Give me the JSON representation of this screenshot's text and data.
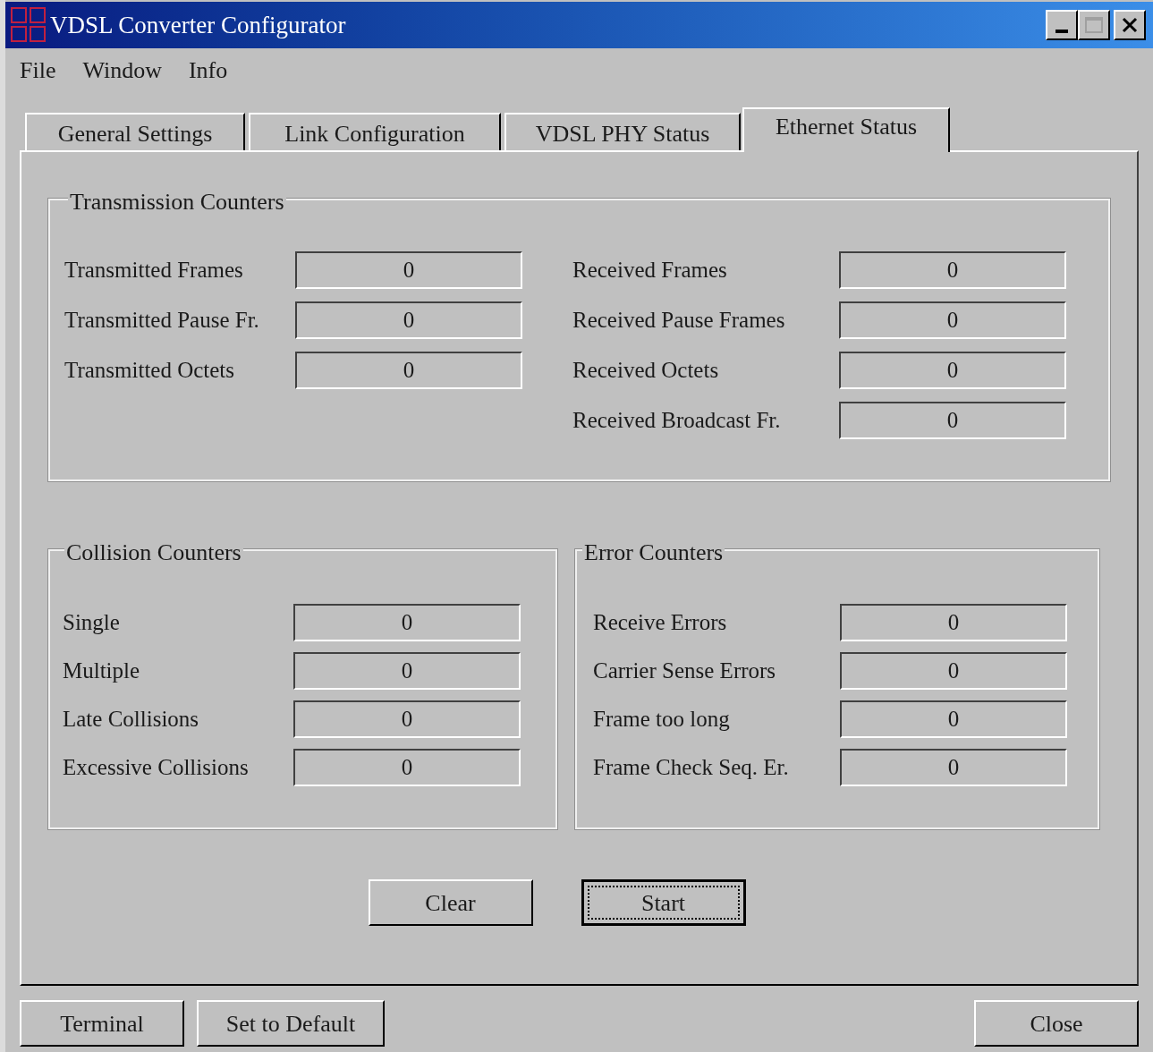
{
  "window": {
    "title": "VDSL Converter Configurator"
  },
  "menu": [
    "File",
    "Window",
    "Info"
  ],
  "tabs": [
    {
      "label": "General Settings",
      "selected": false
    },
    {
      "label": "Link Configuration",
      "selected": false
    },
    {
      "label": "VDSL PHY Status",
      "selected": false
    },
    {
      "label": "Ethernet Status",
      "selected": true
    }
  ],
  "transmission_counters": {
    "title": "Transmission Counters",
    "left": [
      {
        "label": "Transmitted Frames",
        "value": "0"
      },
      {
        "label": "Transmitted Pause Fr.",
        "value": "0"
      },
      {
        "label": "Transmitted Octets",
        "value": "0"
      }
    ],
    "right": [
      {
        "label": "Received Frames",
        "value": "0"
      },
      {
        "label": "Received Pause Frames",
        "value": "0"
      },
      {
        "label": "Received Octets",
        "value": "0"
      },
      {
        "label": "Received Broadcast Fr.",
        "value": "0"
      }
    ]
  },
  "collision_counters": {
    "title": "Collision Counters",
    "rows": [
      {
        "label": "Single",
        "value": "0"
      },
      {
        "label": "Multiple",
        "value": "0"
      },
      {
        "label": "Late Collisions",
        "value": "0"
      },
      {
        "label": "Excessive Collisions",
        "value": "0"
      }
    ]
  },
  "error_counters": {
    "title": "Error Counters",
    "rows": [
      {
        "label": "Receive Errors",
        "value": "0"
      },
      {
        "label": "Carrier Sense Errors",
        "value": "0"
      },
      {
        "label": "Frame too long",
        "value": "0"
      },
      {
        "label": "Frame Check Seq. Er.",
        "value": "0"
      }
    ]
  },
  "panel_buttons": [
    {
      "label": "Clear",
      "focused": false
    },
    {
      "label": "Start",
      "focused": true
    }
  ],
  "footer_buttons": [
    {
      "label": "Terminal"
    },
    {
      "label": "Set to Default"
    },
    {
      "label": "Close"
    }
  ]
}
